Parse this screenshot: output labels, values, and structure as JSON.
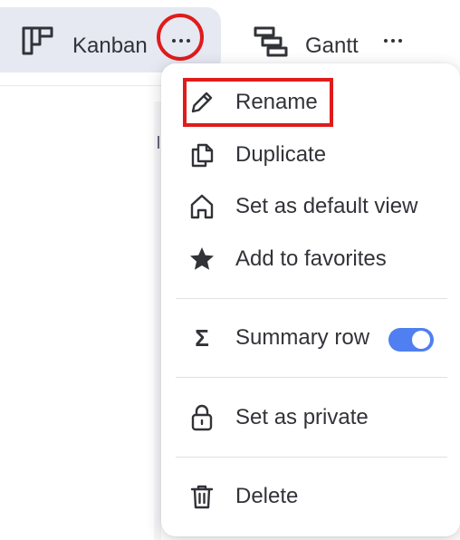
{
  "tabs": [
    {
      "label": "Kanban",
      "icon": "kanban-icon",
      "active": true
    },
    {
      "label": "Gantt",
      "icon": "gantt-icon",
      "active": false
    }
  ],
  "menu": {
    "items": [
      {
        "label": "Rename",
        "icon": "pencil-icon"
      },
      {
        "label": "Duplicate",
        "icon": "duplicate-icon"
      },
      {
        "label": "Set as default view",
        "icon": "home-icon"
      },
      {
        "label": "Add to favorites",
        "icon": "star-icon"
      },
      {
        "label": "Summary row",
        "icon": "sigma-icon",
        "toggle_on": true
      },
      {
        "label": "Set as private",
        "icon": "lock-icon"
      },
      {
        "label": "Delete",
        "icon": "trash-icon"
      }
    ]
  },
  "colors": {
    "highlight": "#e01b1b",
    "toggle_on": "#4f7ff0",
    "active_tab_bg": "#e6e9f2",
    "text": "#323338"
  }
}
